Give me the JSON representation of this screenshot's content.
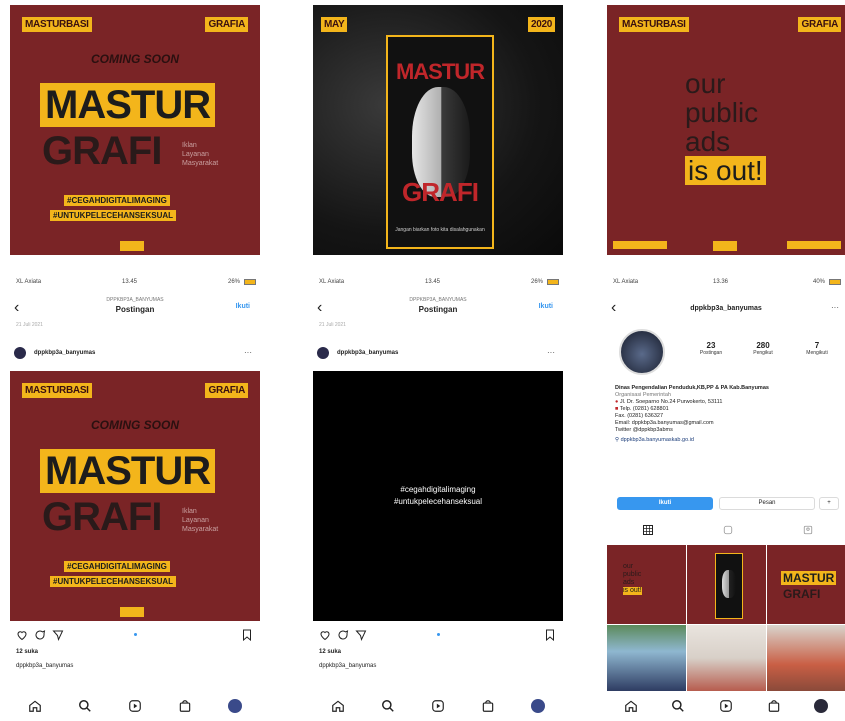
{
  "poster1": {
    "tag_left": "MASTURBASI",
    "tag_right": "GRAFIA",
    "coming": "COMING SOON",
    "mastur": "MASTUR",
    "grafi": "GRAFI",
    "subtitle_lines": [
      "Iklan",
      "Layanan",
      "Masyarakat"
    ],
    "hashtag1": "#CEGAHDIGITALIMAGING",
    "hashtag2": "#UNTUKPELECEHANSEKSUAL"
  },
  "poster2": {
    "tag_left": "MAY",
    "tag_right": "2020",
    "mastur": "MASTUR",
    "grafi": "GRAFI",
    "caption": "Jangan biarkan foto kita disalahgunakan"
  },
  "poster3": {
    "tag_left": "MASTURBASI",
    "tag_right": "GRAFIA",
    "line1": "our",
    "line2": "public",
    "line3": "ads",
    "line4": "is out!"
  },
  "phone1": {
    "carrier": "XL Axiata",
    "time": "13.45",
    "battery": "26%",
    "account_small": "DPPKBP3A_BANYUMAS",
    "title": "Postingan",
    "follow": "Ikuti",
    "date_small": "21 Juli 2021",
    "username": "dppkbp3a_banyumas",
    "more": "···",
    "likes": "12 suka",
    "caption_user": "dppkbp3a_banyumas"
  },
  "phone2": {
    "carrier": "XL Axiata",
    "time": "13.45",
    "battery": "26%",
    "account_small": "DPPKBP3A_BANYUMAS",
    "title": "Postingan",
    "follow": "Ikuti",
    "date_small": "21 Juli 2021",
    "username": "dppkbp3a_banyumas",
    "more": "···",
    "hashtag1": "#cegahdigitalimaging",
    "hashtag2": "#untukpelecehanseksual",
    "likes": "12 suka",
    "caption_user": "dppkbp3a_banyumas"
  },
  "phone3": {
    "carrier": "XL Axiata",
    "time": "13.36",
    "battery": "40%",
    "username": "dppkbp3a_banyumas",
    "posts_count": "23",
    "posts_label": "Postingan",
    "followers_count": "280",
    "followers_label": "Pengikut",
    "following_count": "7",
    "following_label": "Mengikuti",
    "bio_name": "Dinas Pengendalian Penduduk,KB,PP & PA Kab.Banyumas",
    "bio_category": "Organisasi Pemerintah",
    "bio_address": "Jl. Dr. Soeparno No.24 Purwokerto, 53111",
    "bio_phone": "Telp. (0281) 628801",
    "bio_fax": "Fax. (0281) 636327",
    "bio_email": "Email: dppkbp3a.banyumas@gmail.com",
    "bio_twitter": "Twitter @dppkbp3abms",
    "bio_link": "dppkbp3a.banyumaskab.go.id",
    "follow": "Ikuti",
    "message": "Pesan",
    "grid_ads": [
      "our",
      "public",
      "ads",
      "is out!"
    ],
    "grid_mastur": "MASTUR",
    "grid_grafi": "GRAFI"
  },
  "colors": {
    "maroon": "#7a2426",
    "yellow": "#f3b51b",
    "ig_blue": "#3797ef"
  },
  "icons": [
    "back-arrow-icon",
    "heart-icon",
    "comment-icon",
    "share-icon",
    "bookmark-icon",
    "home-icon",
    "search-icon",
    "reels-icon",
    "shop-icon",
    "profile-icon",
    "grid-icon",
    "tagged-icon"
  ]
}
